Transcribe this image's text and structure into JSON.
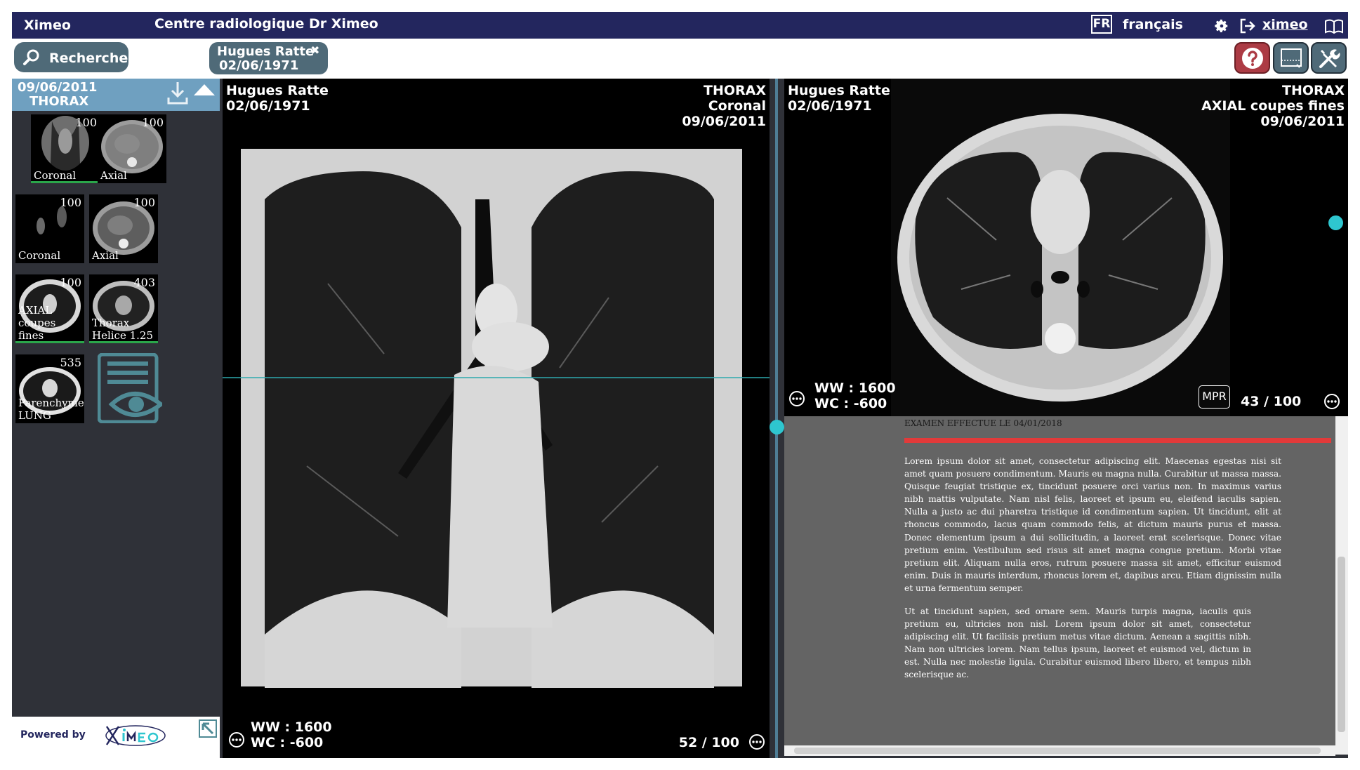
{
  "topbar": {
    "brand": "Ximeo",
    "center_name": "Centre radiologique Dr Ximeo",
    "lang_code": "FR",
    "language": "français",
    "user": "ximeo"
  },
  "toolbar": {
    "search_label": "Recherche",
    "patient_tab": {
      "name": "Hugues Ratte",
      "dob": "02/06/1971",
      "close": "✖"
    }
  },
  "sidebar": {
    "study_date": "09/06/2011",
    "study_modality": "THORAX",
    "series": [
      {
        "count": "100",
        "label": "Coronal"
      },
      {
        "count": "100",
        "label": "Axial"
      },
      {
        "count": "100",
        "label": "Coronal"
      },
      {
        "count": "100",
        "label": "Axial"
      },
      {
        "count": "100",
        "label_line1": "AXIAL",
        "label_line2": "coupes fines"
      },
      {
        "count": "403",
        "label_line1": "Thorax",
        "label_line2": "Helice 1.25"
      },
      {
        "count": "535",
        "label_line1": "Parenchyme",
        "label_line2": "LUNG"
      }
    ],
    "footer_powered": "Powered by"
  },
  "viewport1": {
    "patient_name": "Hugues Ratte",
    "patient_dob": "02/06/1971",
    "region": "THORAX",
    "series": "Coronal",
    "date": "09/06/2011",
    "ww": "WW : 1600",
    "wc": "WC : -600",
    "frame": "52 / 100"
  },
  "viewport2": {
    "patient_name": "Hugues Ratte",
    "patient_dob": "02/06/1971",
    "region": "THORAX",
    "series": "AXIAL coupes fines",
    "date": "09/06/2011",
    "ww": "WW : 1600",
    "wc": "WC : -600",
    "mpr": "MPR",
    "frame": "43 / 100"
  },
  "report": {
    "header": "EXAMEN EFFECTUE LE 04/01/2018",
    "paragraph1": "Lorem ipsum dolor sit amet, consectetur adipiscing elit. Maecenas egestas nisi sit amet quam posuere condimentum. Mauris eu magna nulla. Curabitur ut massa massa. Quisque feugiat tristique ex, tincidunt posuere orci varius non. In maximus varius nibh mattis vulputate. Nam nisl felis, laoreet et ipsum eu, eleifend iaculis sapien. Nulla a justo ac dui pharetra tristique id condimentum sapien. Ut tincidunt, elit at rhoncus commodo, lacus quam commodo felis, at dictum mauris purus et massa. Donec elementum ipsum a dui sollicitudin, a laoreet erat scelerisque. Donec vitae pretium enim. Vestibulum sed risus sit amet magna congue pretium. Morbi vitae pretium elit. Aliquam nulla eros, rutrum posuere massa sit amet, efficitur euismod enim. Duis in mauris interdum, rhoncus lorem et, dapibus arcu. Etiam dignissim nulla et urna fermentum semper.",
    "paragraph2": "Ut at tincidunt sapien, sed ornare sem. Mauris turpis magna, iaculis quis pretium eu, ultricies non nisl. Lorem ipsum dolor sit amet, consectetur adipiscing elit. Ut facilisis pretium metus vitae dictum. Aenean a sagittis nibh. Nam non ultricies lorem. Nam tellus ipsum, laoreet et euismod vel, dictum in est. Nulla nec molestie ligula. Curabitur euismod libero libero, et tempus nibh scelerisque ac."
  },
  "colors": {
    "topbar": "#23265e",
    "button": "#4f6a78",
    "help": "#ac3b44",
    "accent": "#2ec6cf",
    "report_bg": "#646464",
    "report_rule": "#e23a3a"
  }
}
